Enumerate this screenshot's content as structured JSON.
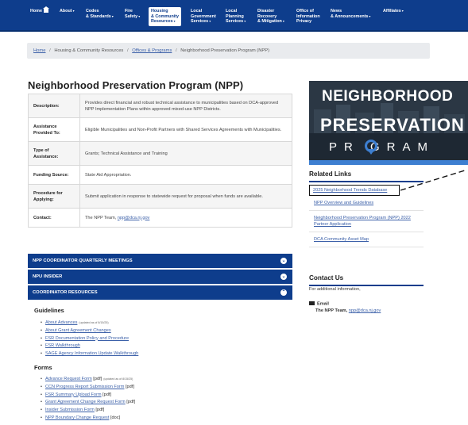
{
  "nav": {
    "home": "Home",
    "items": [
      {
        "label": "About",
        "caret": "▾"
      },
      {
        "label": "Codes\n& Standards",
        "caret": "▾"
      },
      {
        "label": "Fire\nSafety",
        "caret": "▾"
      },
      {
        "label": "Housing\n& Community\nResources",
        "caret": "▾"
      },
      {
        "label": "Local\nGovernment\nServices",
        "caret": "▾"
      },
      {
        "label": "Local\nPlanning\nServices",
        "caret": "▾"
      },
      {
        "label": "Disaster\nRecovery\n& Mitigation",
        "caret": "▾"
      },
      {
        "label": "Office of\nInformation\nPrivacy",
        "caret": ""
      },
      {
        "label": "News\n& Announcements",
        "caret": "▾"
      },
      {
        "label": "Affiliates",
        "caret": "▾"
      }
    ]
  },
  "breadcrumb": {
    "home": "Home",
    "housing": "Housing & Community Resources",
    "offices": "Offices & Programs",
    "current": "Neighborhood Preservation Program (NPP)",
    "sep": "/"
  },
  "page_title": "Neighborhood Preservation Program (NPP)",
  "info": [
    {
      "label": "Description:",
      "value": "Provides direct financial and robust technical assistance to municipalities based on DCA-approved NPP Implementation Plans within approved mixed-use NPP Districts."
    },
    {
      "label": "Assistance Provided To:",
      "value": "Eligible Municipalities and Non-Profit Partners with Shared Services Agreements with Municipalities."
    },
    {
      "label": "Type of Assistance:",
      "value": "Grants; Technical Assistance and Training"
    },
    {
      "label": "Funding Source:",
      "value": "State Aid Appropriation."
    },
    {
      "label": "Procedure for Applying:",
      "value": "Submit application in response to statewide request for proposal when funds are available."
    },
    {
      "label": "Contact:",
      "value": "The NPP Team,",
      "email": "npp@dca.nj.gov"
    }
  ],
  "accordion": [
    {
      "label": "NPP COORDINATOR QUARTERLY MEETINGS",
      "chev": "⌄"
    },
    {
      "label": "NPU INSIDER",
      "chev": "⌄"
    },
    {
      "label": "COORDINATOR RESOURCES",
      "chev": "⌃"
    }
  ],
  "guidelines": {
    "title": "Guidelines",
    "items": [
      {
        "text": "About Advances",
        "note": "(updated as of 8/15/25)"
      },
      {
        "text": "About Grant Agreement Changes"
      },
      {
        "text": "FSR Documentation Policy and Procedure"
      },
      {
        "text": "FSR Walkthrough"
      },
      {
        "text": "SAGE Agency Information Update Walkthrough"
      }
    ]
  },
  "forms": {
    "title": "Forms",
    "items": [
      {
        "text": "Advance Request Form",
        "suffix": " [pdf]",
        "note": "(updated as of 8/15/25)"
      },
      {
        "text": "CCN Progress Report Submission Form",
        "suffix": " [pdf]"
      },
      {
        "text": "FSR Summary Upload Form",
        "suffix": " [pdf]"
      },
      {
        "text": "Grant Agreement Change Request Form",
        "suffix": " [pdf]"
      },
      {
        "text": "Insider Submission Form",
        "suffix": " [pdf]"
      },
      {
        "text": "NPP Boundary Change Request",
        "suffix": " [doc]"
      }
    ]
  },
  "logo": {
    "line1": "NEIGHBORHOOD",
    "line2": "PRESERVATION",
    "line3": "PR GRAM",
    "pin_color": "#3d7fd1"
  },
  "related": {
    "title": "Related Links",
    "items": [
      "2025 Neighborhood Trends Database",
      "NPP Overview and Guidelines",
      "Neighborhood Preservation Program (NPP) 2022 Partner Application",
      "DCA Community Asset Map"
    ]
  },
  "contact": {
    "title": "Contact Us",
    "intro": "For additional information,",
    "email_label": "Email",
    "team": "The NPP Team,",
    "email": "npp@dca.nj.gov"
  },
  "colors": {
    "nav": "#0e3d8c",
    "link": "#3a5fa8",
    "accent": "#3d7fd1"
  }
}
